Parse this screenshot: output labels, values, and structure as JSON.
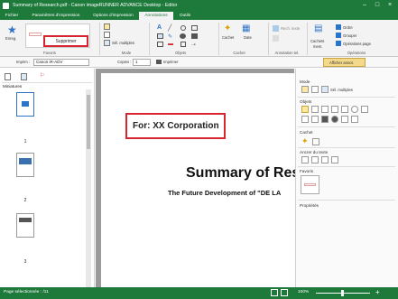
{
  "window": {
    "title": "Summary of Research.pdf - Canon imageRUNNER ADVANCE Desktop - Editor",
    "minimize": "–",
    "maximize": "□",
    "close": "×"
  },
  "ribbon_tabs": [
    "Fichier",
    "Paramètres d'impression",
    "Options d'impression",
    "Annotations",
    "Outils"
  ],
  "ribbon": {
    "enreg_label": "Enreg.",
    "supprimer_label": "Supprimer",
    "favoris_group": "Favoris",
    "mode_group": "Mode",
    "sel_multiples": "Sél. multiples",
    "objets_group": "Objets",
    "cachet_group": "Cachet",
    "cachet_btn": "Cachet",
    "date_btn": "Date",
    "annotation_group": "Annotation tel.",
    "rech_texte": "Rech. texte",
    "cachets_btn": "Cachets",
    "cachets_sub": "mem.",
    "operations_group": "Opérations",
    "ordre": "Ordre",
    "grouper": "Grouper",
    "operations_page": "Opérations page"
  },
  "toolbar": {
    "imprim_label": "Imprim :",
    "printer_value": "Canon iR-ADV",
    "copies_label": "Copies :",
    "copies_value": "1",
    "imprimer_btn": "Imprimer",
    "afficher_annot": "Afficher annot."
  },
  "left_pane": {
    "title": "Miniatures",
    "thumbs": [
      "1",
      "2",
      "3"
    ]
  },
  "document": {
    "annotation_text": "For: XX Corporation",
    "heading": "Summary of Res",
    "subheading": "The Future Development of \"DE LA"
  },
  "right_pane": {
    "mode_title": "Mode",
    "sel_multiples": "Sél. multiples",
    "objets_title": "Objets",
    "cachet_title": "Cachet",
    "ancrer_title": "Ancrer du texte",
    "favoris_title": "Favoris",
    "proprietes_title": "Propriétés"
  },
  "status": {
    "page_text": "Page sélectionnée : /11",
    "zoom": "100%"
  },
  "colors": {
    "title_green": "#1e7a3b",
    "highlight_red": "#d7262f"
  }
}
